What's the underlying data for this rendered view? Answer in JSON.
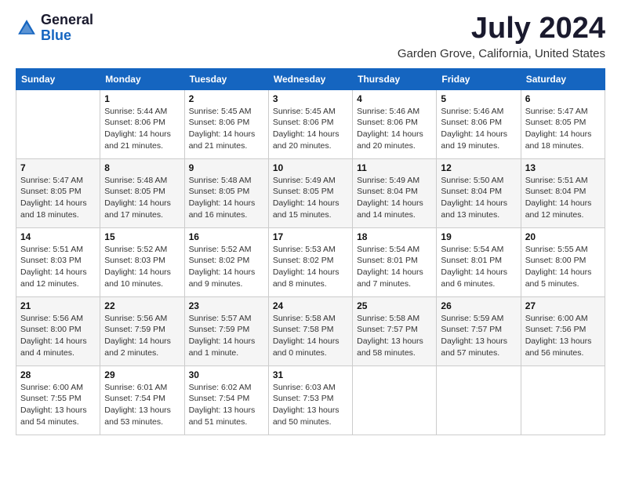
{
  "header": {
    "logo_general": "General",
    "logo_blue": "Blue",
    "month_year": "July 2024",
    "location": "Garden Grove, California, United States"
  },
  "days_of_week": [
    "Sunday",
    "Monday",
    "Tuesday",
    "Wednesday",
    "Thursday",
    "Friday",
    "Saturday"
  ],
  "weeks": [
    [
      {
        "day": "",
        "info": ""
      },
      {
        "day": "1",
        "info": "Sunrise: 5:44 AM\nSunset: 8:06 PM\nDaylight: 14 hours\nand 21 minutes."
      },
      {
        "day": "2",
        "info": "Sunrise: 5:45 AM\nSunset: 8:06 PM\nDaylight: 14 hours\nand 21 minutes."
      },
      {
        "day": "3",
        "info": "Sunrise: 5:45 AM\nSunset: 8:06 PM\nDaylight: 14 hours\nand 20 minutes."
      },
      {
        "day": "4",
        "info": "Sunrise: 5:46 AM\nSunset: 8:06 PM\nDaylight: 14 hours\nand 20 minutes."
      },
      {
        "day": "5",
        "info": "Sunrise: 5:46 AM\nSunset: 8:06 PM\nDaylight: 14 hours\nand 19 minutes."
      },
      {
        "day": "6",
        "info": "Sunrise: 5:47 AM\nSunset: 8:05 PM\nDaylight: 14 hours\nand 18 minutes."
      }
    ],
    [
      {
        "day": "7",
        "info": "Sunrise: 5:47 AM\nSunset: 8:05 PM\nDaylight: 14 hours\nand 18 minutes."
      },
      {
        "day": "8",
        "info": "Sunrise: 5:48 AM\nSunset: 8:05 PM\nDaylight: 14 hours\nand 17 minutes."
      },
      {
        "day": "9",
        "info": "Sunrise: 5:48 AM\nSunset: 8:05 PM\nDaylight: 14 hours\nand 16 minutes."
      },
      {
        "day": "10",
        "info": "Sunrise: 5:49 AM\nSunset: 8:05 PM\nDaylight: 14 hours\nand 15 minutes."
      },
      {
        "day": "11",
        "info": "Sunrise: 5:49 AM\nSunset: 8:04 PM\nDaylight: 14 hours\nand 14 minutes."
      },
      {
        "day": "12",
        "info": "Sunrise: 5:50 AM\nSunset: 8:04 PM\nDaylight: 14 hours\nand 13 minutes."
      },
      {
        "day": "13",
        "info": "Sunrise: 5:51 AM\nSunset: 8:04 PM\nDaylight: 14 hours\nand 12 minutes."
      }
    ],
    [
      {
        "day": "14",
        "info": "Sunrise: 5:51 AM\nSunset: 8:03 PM\nDaylight: 14 hours\nand 12 minutes."
      },
      {
        "day": "15",
        "info": "Sunrise: 5:52 AM\nSunset: 8:03 PM\nDaylight: 14 hours\nand 10 minutes."
      },
      {
        "day": "16",
        "info": "Sunrise: 5:52 AM\nSunset: 8:02 PM\nDaylight: 14 hours\nand 9 minutes."
      },
      {
        "day": "17",
        "info": "Sunrise: 5:53 AM\nSunset: 8:02 PM\nDaylight: 14 hours\nand 8 minutes."
      },
      {
        "day": "18",
        "info": "Sunrise: 5:54 AM\nSunset: 8:01 PM\nDaylight: 14 hours\nand 7 minutes."
      },
      {
        "day": "19",
        "info": "Sunrise: 5:54 AM\nSunset: 8:01 PM\nDaylight: 14 hours\nand 6 minutes."
      },
      {
        "day": "20",
        "info": "Sunrise: 5:55 AM\nSunset: 8:00 PM\nDaylight: 14 hours\nand 5 minutes."
      }
    ],
    [
      {
        "day": "21",
        "info": "Sunrise: 5:56 AM\nSunset: 8:00 PM\nDaylight: 14 hours\nand 4 minutes."
      },
      {
        "day": "22",
        "info": "Sunrise: 5:56 AM\nSunset: 7:59 PM\nDaylight: 14 hours\nand 2 minutes."
      },
      {
        "day": "23",
        "info": "Sunrise: 5:57 AM\nSunset: 7:59 PM\nDaylight: 14 hours\nand 1 minute."
      },
      {
        "day": "24",
        "info": "Sunrise: 5:58 AM\nSunset: 7:58 PM\nDaylight: 14 hours\nand 0 minutes."
      },
      {
        "day": "25",
        "info": "Sunrise: 5:58 AM\nSunset: 7:57 PM\nDaylight: 13 hours\nand 58 minutes."
      },
      {
        "day": "26",
        "info": "Sunrise: 5:59 AM\nSunset: 7:57 PM\nDaylight: 13 hours\nand 57 minutes."
      },
      {
        "day": "27",
        "info": "Sunrise: 6:00 AM\nSunset: 7:56 PM\nDaylight: 13 hours\nand 56 minutes."
      }
    ],
    [
      {
        "day": "28",
        "info": "Sunrise: 6:00 AM\nSunset: 7:55 PM\nDaylight: 13 hours\nand 54 minutes."
      },
      {
        "day": "29",
        "info": "Sunrise: 6:01 AM\nSunset: 7:54 PM\nDaylight: 13 hours\nand 53 minutes."
      },
      {
        "day": "30",
        "info": "Sunrise: 6:02 AM\nSunset: 7:54 PM\nDaylight: 13 hours\nand 51 minutes."
      },
      {
        "day": "31",
        "info": "Sunrise: 6:03 AM\nSunset: 7:53 PM\nDaylight: 13 hours\nand 50 minutes."
      },
      {
        "day": "",
        "info": ""
      },
      {
        "day": "",
        "info": ""
      },
      {
        "day": "",
        "info": ""
      }
    ]
  ]
}
